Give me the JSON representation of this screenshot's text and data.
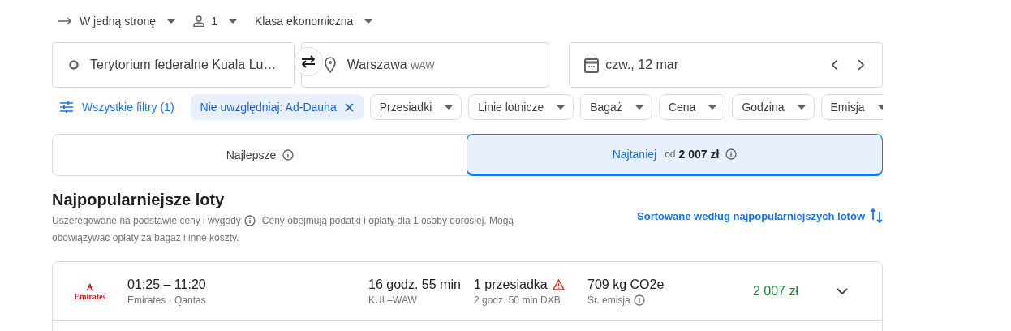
{
  "trip": {
    "type_label": "W jedną stronę",
    "passengers": "1",
    "cabin": "Klasa ekonomiczna"
  },
  "search": {
    "origin": "Terytorium federalne Kuala Lu…",
    "destination": {
      "city": "Warszawa",
      "code": "WAW"
    },
    "date": "czw., 12 mar"
  },
  "filters": [
    {
      "kind": "all",
      "label": "Wszystkie filtry (1)"
    },
    {
      "kind": "active",
      "label": "Nie uwzględniaj: Ad-Dauha"
    },
    {
      "kind": "dropdown",
      "label": "Przesiadki"
    },
    {
      "kind": "dropdown",
      "label": "Linie lotnicze"
    },
    {
      "kind": "dropdown",
      "label": "Bagaż"
    },
    {
      "kind": "dropdown",
      "label": "Cena"
    },
    {
      "kind": "dropdown",
      "label": "Godzina"
    },
    {
      "kind": "dropdown",
      "label": "Emisja"
    }
  ],
  "sort_tabs": [
    {
      "label": "Najlepsze",
      "selected": false
    },
    {
      "label": "Najtaniej",
      "prefix": "od",
      "price": "2 007 zł",
      "selected": true
    }
  ],
  "section": {
    "title": "Najpopularniejsze loty",
    "subtitle": "Uszeregowane na podstawie ceny i wygody",
    "note_lines": [
      "Ceny obejmują podatki i opłaty dla 1 osoby dorosłej. Mogą",
      "obowiązywać opłaty za bagaż i inne koszty."
    ],
    "sort_link": "Sortowane według najpopularniejszych lotów"
  },
  "flights": [
    {
      "logo_text": "Emirates",
      "times": "01:25 – 11:20",
      "airlines": "Emirates · Qantas",
      "duration": "16 godz. 55 min",
      "route": "KUL–WAW",
      "stops": "1 przesiadka",
      "warning": true,
      "stop_detail": "2 godz. 50 min DXB",
      "emissions": "709 kg CO2e",
      "emissions_label": "Śr. emisja",
      "price": "2 007 zł",
      "expanded": false
    }
  ]
}
